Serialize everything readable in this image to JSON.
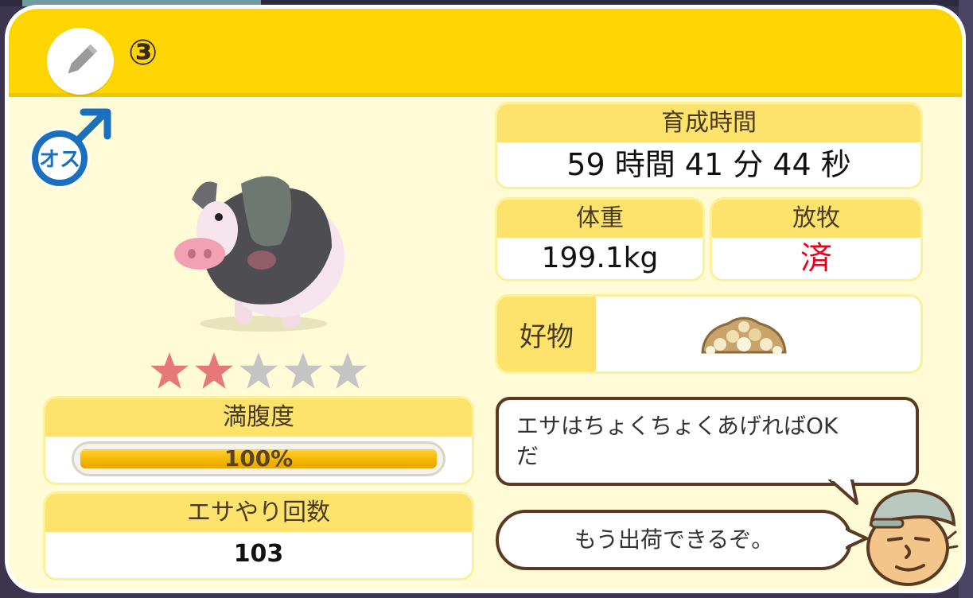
{
  "header": {
    "index_label": "③",
    "edit_icon": "pencil-icon"
  },
  "animal": {
    "gender_label": "オス",
    "gender_icon": "male-symbol-icon",
    "image": "pig-illustration",
    "rating": 2,
    "rating_max": 5
  },
  "fullness": {
    "label": "満腹度",
    "percent_text": "100%",
    "value": 1.0
  },
  "feed_count": {
    "label": "エサやり回数",
    "value": "103"
  },
  "growth_time": {
    "label": "育成時間",
    "value": "59 時間 41 分 44 秒"
  },
  "weight": {
    "label": "体重",
    "value": "199.1kg"
  },
  "pasture": {
    "label": "放牧",
    "value": "済",
    "value_color": "#e8001c"
  },
  "favorite": {
    "label": "好物",
    "icon": "grain-pile-icon"
  },
  "speech": {
    "message1": "エサはちょくちょくあげればOK\nだ",
    "message2": "もう出荷できるぞ。",
    "speaker_icon": "farmer-face-icon"
  },
  "colors": {
    "header": "#fdd500",
    "card_bg": "#fffbd6",
    "star_on": "#e7787a",
    "star_off": "#c4c4c4",
    "accent_blue": "#1a6fbf"
  }
}
